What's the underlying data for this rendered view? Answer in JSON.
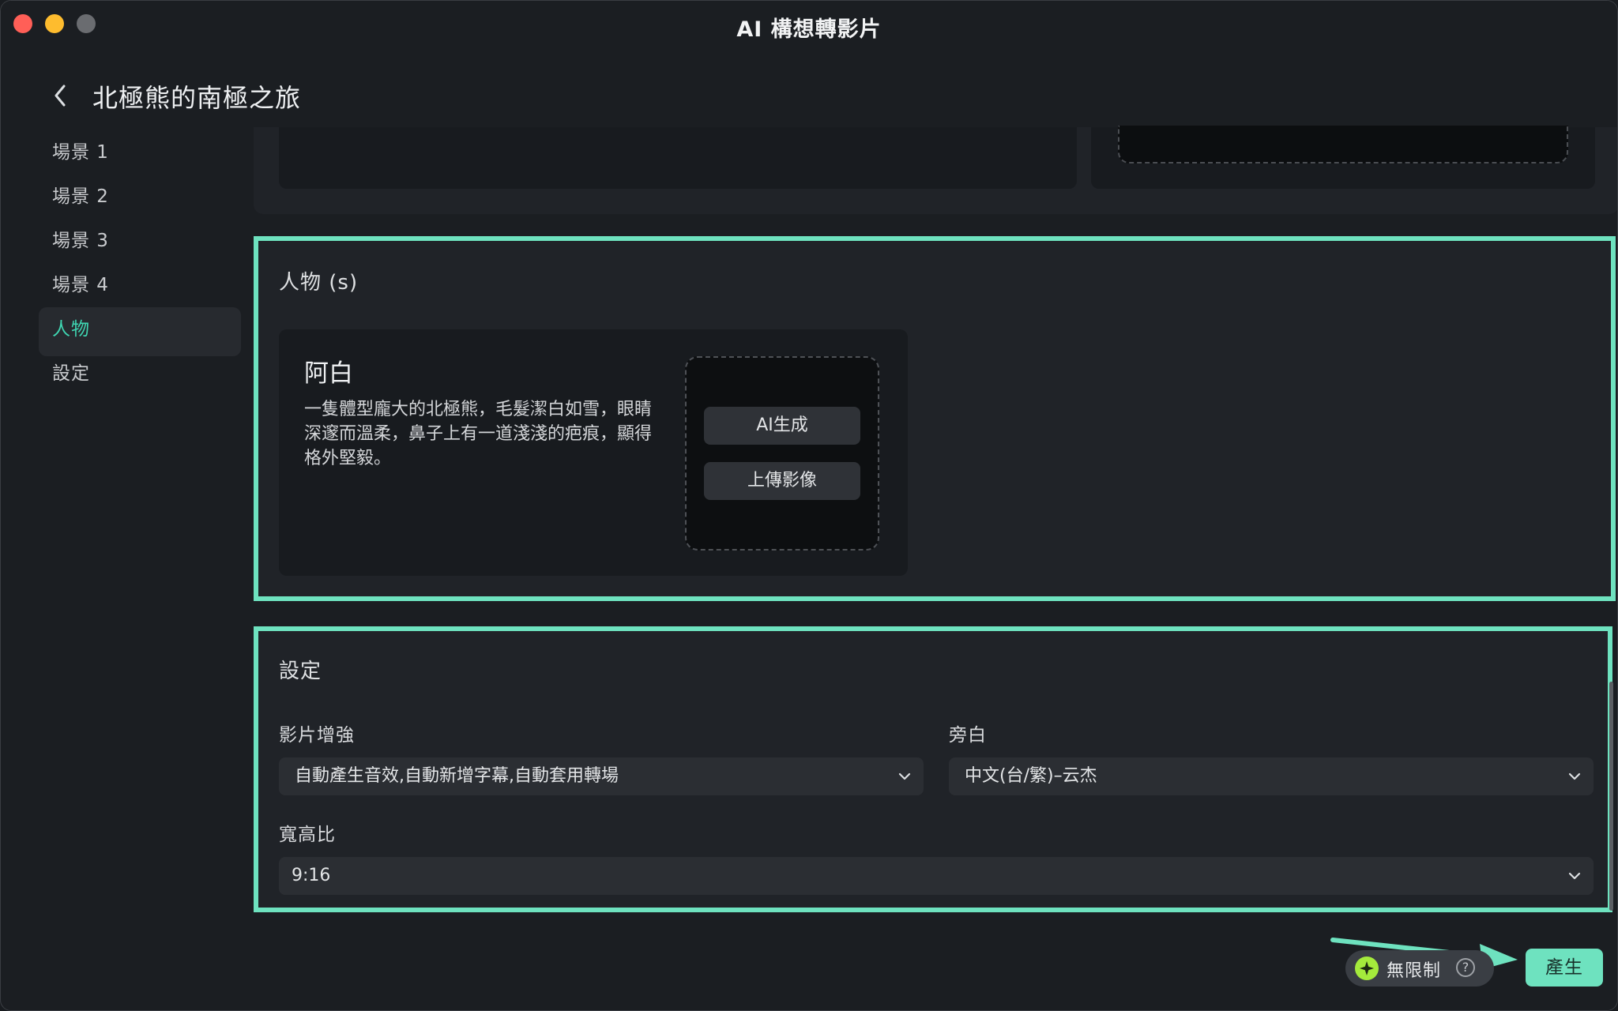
{
  "window": {
    "title": "AI 構想轉影片"
  },
  "header": {
    "project_title": "北極熊的南極之旅"
  },
  "sidebar": {
    "items": [
      {
        "label": "場景 1"
      },
      {
        "label": "場景 2"
      },
      {
        "label": "場景 3"
      },
      {
        "label": "場景 4"
      },
      {
        "label": "人物",
        "active": true
      },
      {
        "label": "設定"
      }
    ]
  },
  "characters": {
    "heading": "人物 (s)",
    "items": [
      {
        "name": "阿白",
        "description": "一隻體型龐大的北極熊，毛髮潔白如雪，眼睛深邃而溫柔，鼻子上有一道淺淺的疤痕，顯得格外堅毅。",
        "ai_generate_label": "AI生成",
        "upload_label": "上傳影像"
      }
    ]
  },
  "settings": {
    "heading": "設定",
    "enhance_label": "影片增強",
    "enhance_value": "自動產生音效,自動新增字幕,自動套用轉場",
    "narration_label": "旁白",
    "narration_value": "中文(台/繁)–云杰",
    "aspect_label": "寬高比",
    "aspect_value": "9:16"
  },
  "footer": {
    "plan_label": "無限制",
    "help_symbol": "?",
    "generate_label": "產生"
  },
  "colors": {
    "accent": "#6ee2bf",
    "active_text": "#3fd6b2",
    "background": "#1b1e22",
    "panel": "#202328"
  }
}
